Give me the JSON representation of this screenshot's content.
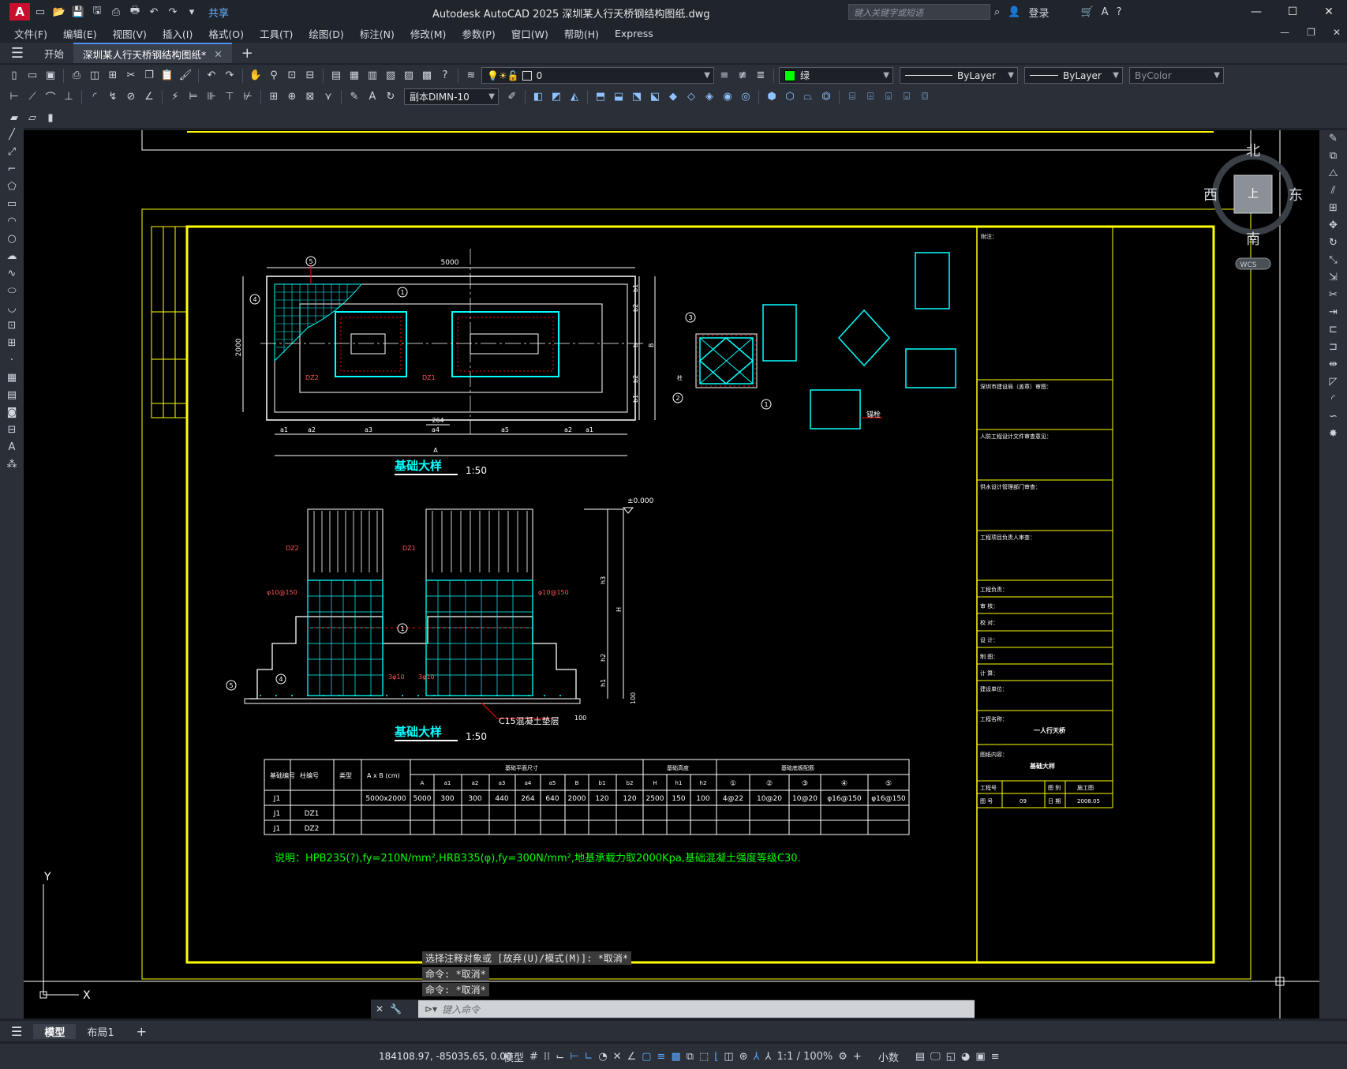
{
  "app": {
    "logo": "A",
    "title": "Autodesk AutoCAD 2025    深圳某人行天桥钢结构图纸.dwg",
    "share": "共享",
    "search_placeholder": "键入关键字或短语",
    "login": "登录"
  },
  "menu": [
    "文件(F)",
    "编辑(E)",
    "视图(V)",
    "插入(I)",
    "格式(O)",
    "工具(T)",
    "绘图(D)",
    "标注(N)",
    "修改(M)",
    "参数(P)",
    "窗口(W)",
    "帮助(H)",
    "Express"
  ],
  "tabs": {
    "start": "开始",
    "drawing": "深圳某人行天桥钢结构图纸*"
  },
  "toolbar": {
    "layer_name": "0",
    "color": "绿",
    "linetype": "ByLayer",
    "lineweight": "ByLayer",
    "plotstyle": "ByColor",
    "dimstyle": "副本DIMN-10"
  },
  "viewcube": {
    "north": "北",
    "south": "南",
    "east": "东",
    "west": "西",
    "top": "上",
    "wcs": "WCS"
  },
  "drawing": {
    "plan_title": "基础大样",
    "plan_scale": "1:50",
    "section_title": "基础大样",
    "section_scale": "1:50",
    "dims": {
      "total_len": "5000",
      "width": "2000",
      "d264": "264",
      "A": "A",
      "B": "B",
      "a_labels": [
        "a1",
        "a2",
        "a3",
        "a4",
        "a5",
        "a2",
        "a1"
      ],
      "b_labels": [
        "b1",
        "b2",
        "b",
        "b2",
        "b1"
      ],
      "h_labels": [
        "h3",
        "H",
        "h2",
        "h1"
      ],
      "elev": "±0.000",
      "d100": "100"
    },
    "labels": {
      "dz2": "DZ2",
      "dz1": "DZ1",
      "phi10": "φ10@150",
      "bar3": "3φ10",
      "c15": "C15混凝土垫层",
      "anchor": "锚栓",
      "col_label": "柱"
    },
    "callouts": [
      "1",
      "2",
      "3",
      "4",
      "5"
    ],
    "note": "说明：HPB235(?),fy=210N/mm²,HRB335(φ),fy=300N/mm²,地基承载力取2000Kpa,基础混凝土强度等级C30.",
    "table": {
      "headers": [
        "基础编号",
        "柱编号",
        "类型",
        "A x B (cm)",
        "基础平面尺寸",
        "基础高度",
        "基础底板配筋"
      ],
      "subheaders": [
        "A",
        "a1",
        "a2",
        "a3",
        "a4",
        "a5",
        "B",
        "b1",
        "b2",
        "H",
        "h1",
        "h2",
        "①",
        "②",
        "③",
        "④",
        "⑤"
      ],
      "rows": [
        [
          "J1",
          "",
          "",
          "5000x2000",
          "5000",
          "300",
          "300",
          "440",
          "264",
          "640",
          "2000",
          "120",
          "120",
          "2500",
          "150",
          "100",
          "4@22",
          "10@20",
          "10@20",
          "φ16@150",
          "φ16@150"
        ],
        [
          "J1",
          "DZ1",
          "",
          "",
          "",
          "",
          "",
          "",
          "",
          "",
          "",
          "",
          "",
          "",
          "",
          "",
          "",
          "",
          "",
          "",
          ""
        ],
        [
          "J1",
          "DZ2",
          "",
          "",
          "",
          "",
          "",
          "",
          "",
          "",
          "",
          "",
          "",
          "",
          "",
          "",
          "",
          "",
          "",
          "",
          ""
        ]
      ]
    },
    "titleblock": {
      "notes": "附注：",
      "rows": [
        "深圳市建设局（盖章）审图：",
        "人防工程设计文件审查意见：",
        "供水设计管理部门审查：",
        "工程项目负责人审查：",
        "工程负责：",
        "审  核：",
        "校  对：",
        "设  计：",
        "制  图：",
        "计  算：",
        "建设单位：",
        "工程名称：",
        "图纸内容："
      ],
      "project": "一人行天桥",
      "content": "基础大样",
      "no_label": "工程号",
      "stage_label": "图 别",
      "stage": "施工图",
      "sheet_label": "图 号",
      "sheet": "09",
      "date_label": "日 期",
      "date": "2008.05"
    }
  },
  "command": {
    "history": [
      "选择注释对象或 [放弃(U)/模式(M)]: *取消*",
      "命令: *取消*",
      "命令: *取消*"
    ],
    "placeholder": "键入命令"
  },
  "layouts": {
    "model": "模型",
    "layout1": "布局1"
  },
  "status": {
    "coords": "184108.97, -85035.65, 0.00",
    "model": "模型",
    "scale": "1:1 / 100%",
    "units": "小数"
  }
}
